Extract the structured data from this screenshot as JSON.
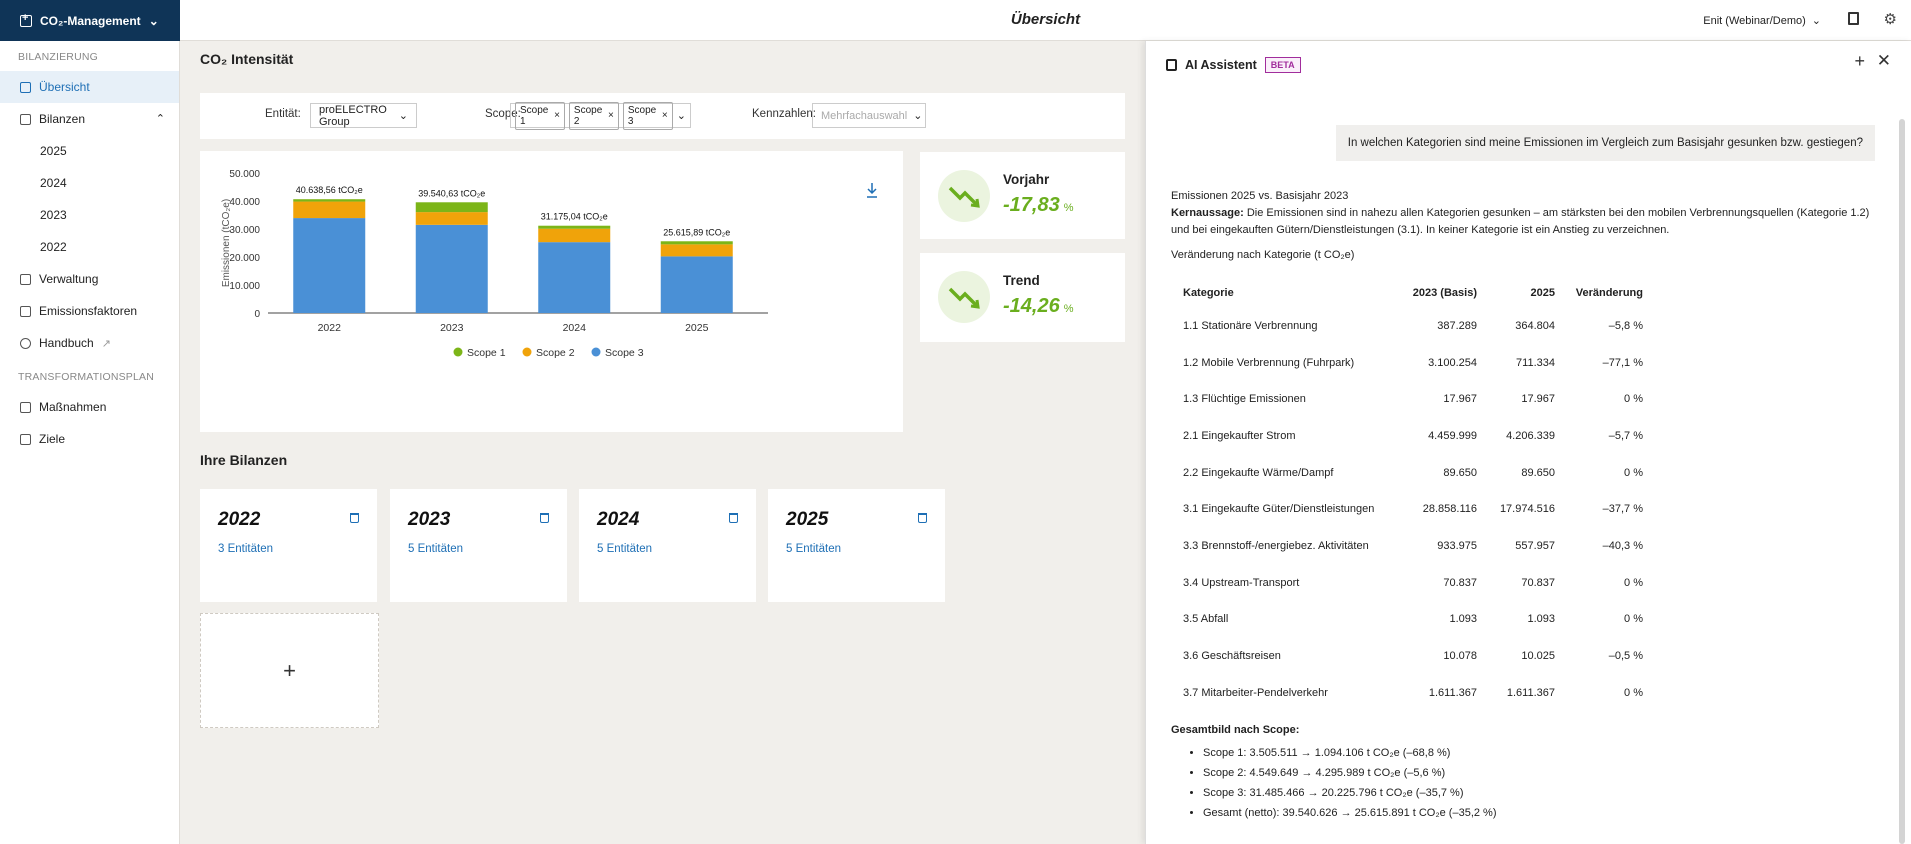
{
  "app": {
    "brand": "CO₂-Management",
    "page_title": "Übersicht",
    "env": "Enit (Webinar/Demo)"
  },
  "sidebar": {
    "section1": "BILANZIERUNG",
    "items": [
      {
        "label": "Übersicht"
      },
      {
        "label": "Bilanzen"
      },
      {
        "label": "2025"
      },
      {
        "label": "2024"
      },
      {
        "label": "2023"
      },
      {
        "label": "2022"
      },
      {
        "label": "Verwaltung"
      },
      {
        "label": "Emissionsfaktoren"
      },
      {
        "label": "Handbuch"
      }
    ],
    "section2": "TRANSFORMATIONSPLAN",
    "items2": [
      {
        "label": "Maßnahmen"
      },
      {
        "label": "Ziele"
      }
    ]
  },
  "main": {
    "intensity_title": "CO₂ Intensität",
    "filters": {
      "entity_label": "Entität:",
      "entity_value": "proELECTRO Group",
      "scope_label": "Scope:",
      "scope_tags": [
        "Scope 1",
        "Scope 2",
        "Scope 3"
      ],
      "kpi_label": "Kennzahlen:",
      "kpi_placeholder": "Mehrfachauswahl"
    },
    "kpis": [
      {
        "title": "Vorjahr",
        "value": "-17,83",
        "unit": "%"
      },
      {
        "title": "Trend",
        "value": "-14,26",
        "unit": "%"
      }
    ],
    "bilanzen_title": "Ihre Bilanzen",
    "bilanzen": [
      {
        "year": "2022",
        "entities": "3 Entitäten"
      },
      {
        "year": "2023",
        "entities": "5 Entitäten"
      },
      {
        "year": "2024",
        "entities": "5 Entitäten"
      },
      {
        "year": "2025",
        "entities": "5 Entitäten"
      }
    ],
    "add_symbol": "+"
  },
  "chart_data": {
    "type": "bar",
    "stacked": true,
    "categories": [
      "2022",
      "2023",
      "2024",
      "2025"
    ],
    "series": [
      {
        "name": "Scope 3",
        "color": "#4a90d6",
        "values": [
          33900,
          31485,
          25300,
          20226
        ]
      },
      {
        "name": "Scope 2",
        "color": "#f0a30a",
        "values": [
          5900,
          4550,
          4800,
          4296
        ]
      },
      {
        "name": "Scope 1",
        "color": "#7cb518",
        "values": [
          839,
          3506,
          1075,
          1094
        ]
      }
    ],
    "totals_labels": [
      "40.638,56 tCO₂e",
      "39.540,63 tCO₂e",
      "31.175,04 tCO₂e",
      "25.615,89 tCO₂e"
    ],
    "totals": [
      40638.56,
      39540.63,
      31175.04,
      25615.89
    ],
    "ylabel": "Emissionen (tCO₂e)",
    "ylim": [
      0,
      50000
    ],
    "yticks": [
      "0",
      "10.000",
      "20.000",
      "30.000",
      "40.000",
      "50.000"
    ],
    "legend": [
      "Scope 1",
      "Scope 2",
      "Scope 3"
    ],
    "legend_position": "bottom"
  },
  "assistant": {
    "title": "AI Assistent",
    "badge": "BETA",
    "question": "In welchen Kategorien sind meine Emissionen im Vergleich zum Basisjahr gesunken bzw. gestiegen?",
    "heading": "Emissionen 2025 vs. Basisjahr 2023",
    "kern_label": "Kernaussage:",
    "kern_text": " Die Emissionen sind in nahezu allen Kategorien gesunken – am stärksten bei den mobilen Verbrennungsquellen (Kategorie 1.2) und bei eingekauften Gütern/Dienstleistungen (3.1). In keiner Kategorie ist ein Anstieg zu verzeichnen.",
    "table_title": "Veränderung nach Kategorie (t CO₂e)",
    "columns": [
      "Kategorie",
      "2023 (Basis)",
      "2025",
      "Veränderung"
    ],
    "rows": [
      [
        "1.1 Stationäre Verbrennung",
        "387.289",
        "364.804",
        "–5,8 %"
      ],
      [
        "1.2 Mobile Verbrennung (Fuhrpark)",
        "3.100.254",
        "711.334",
        "–77,1 %"
      ],
      [
        "1.3 Flüchtige Emissionen",
        "17.967",
        "17.967",
        "0 %"
      ],
      [
        "2.1 Eingekaufter Strom",
        "4.459.999",
        "4.206.339",
        "–5,7 %"
      ],
      [
        "2.2 Eingekaufte Wärme/Dampf",
        "89.650",
        "89.650",
        "0 %"
      ],
      [
        "3.1 Eingekaufte Güter/Dienstleistungen",
        "28.858.116",
        "17.974.516",
        "–37,7 %"
      ],
      [
        "3.3 Brennstoff-/energiebez. Aktivitäten",
        "933.975",
        "557.957",
        "–40,3 %"
      ],
      [
        "3.4 Upstream-Transport",
        "70.837",
        "70.837",
        "0 %"
      ],
      [
        "3.5 Abfall",
        "1.093",
        "1.093",
        "0 %"
      ],
      [
        "3.6 Geschäftsreisen",
        "10.078",
        "10.025",
        "–0,5 %"
      ],
      [
        "3.7 Mitarbeiter-Pendelverkehr",
        "1.611.367",
        "1.611.367",
        "0 %"
      ]
    ],
    "scope_title": "Gesamtbild nach Scope:",
    "scope_items": [
      "Scope 1: 3.505.511 → 1.094.106 t CO₂e (–68,8 %)",
      "Scope 2: 4.549.649 → 4.295.989 t CO₂e (–5,6 %)",
      "Scope 3: 31.485.466 → 20.225.796 t CO₂e (–35,7 %)",
      "Gesamt (netto): 39.540.626 → 25.615.891 t CO₂e (–35,2 %)"
    ]
  }
}
